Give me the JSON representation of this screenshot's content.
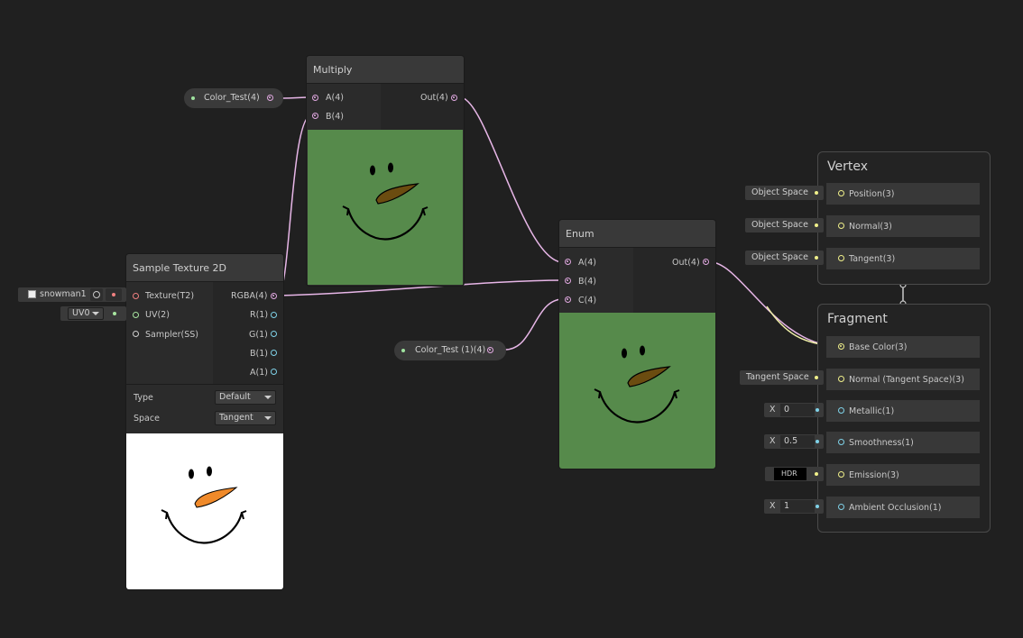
{
  "colors": {
    "pink_wire": "#e7b6e7",
    "yellow_wire": "#f0f0a8",
    "preview_green": "#568a4b"
  },
  "multiply": {
    "title": "Multiply",
    "inputs": [
      "A(4)",
      "B(4)"
    ],
    "output": "Out(4)"
  },
  "color_test_1": {
    "label": "Color_Test(4)"
  },
  "color_test_2": {
    "label": "Color_Test (1)(4)"
  },
  "sample_texture": {
    "title": "Sample Texture 2D",
    "inputs": [
      "Texture(T2)",
      "UV(2)",
      "Sampler(SS)"
    ],
    "outputs": [
      "RGBA(4)",
      "R(1)",
      "G(1)",
      "B(1)",
      "A(1)"
    ],
    "type_label": "Type",
    "type_value": "Default",
    "space_label": "Space",
    "space_value": "Tangent",
    "texture_input": "snowman1",
    "uv_input": "UV0"
  },
  "enum": {
    "title": "Enum",
    "inputs": [
      "A(4)",
      "B(4)",
      "C(4)"
    ],
    "output": "Out(4)"
  },
  "vertex": {
    "title": "Vertex",
    "slots": [
      {
        "label": "Position(3)",
        "input": "Object Space"
      },
      {
        "label": "Normal(3)",
        "input": "Object Space"
      },
      {
        "label": "Tangent(3)",
        "input": "Object Space"
      }
    ]
  },
  "fragment": {
    "title": "Fragment",
    "slots": [
      {
        "label": "Base Color(3)",
        "input": ""
      },
      {
        "label": "Normal (Tangent Space)(3)",
        "input": "Tangent Space"
      },
      {
        "label": "Metallic(1)",
        "axis": "X",
        "value": "0"
      },
      {
        "label": "Smoothness(1)",
        "axis": "X",
        "value": "0.5"
      },
      {
        "label": "Emission(3)",
        "input": "HDR"
      },
      {
        "label": "Ambient Occlusion(1)",
        "axis": "X",
        "value": "1"
      }
    ]
  }
}
